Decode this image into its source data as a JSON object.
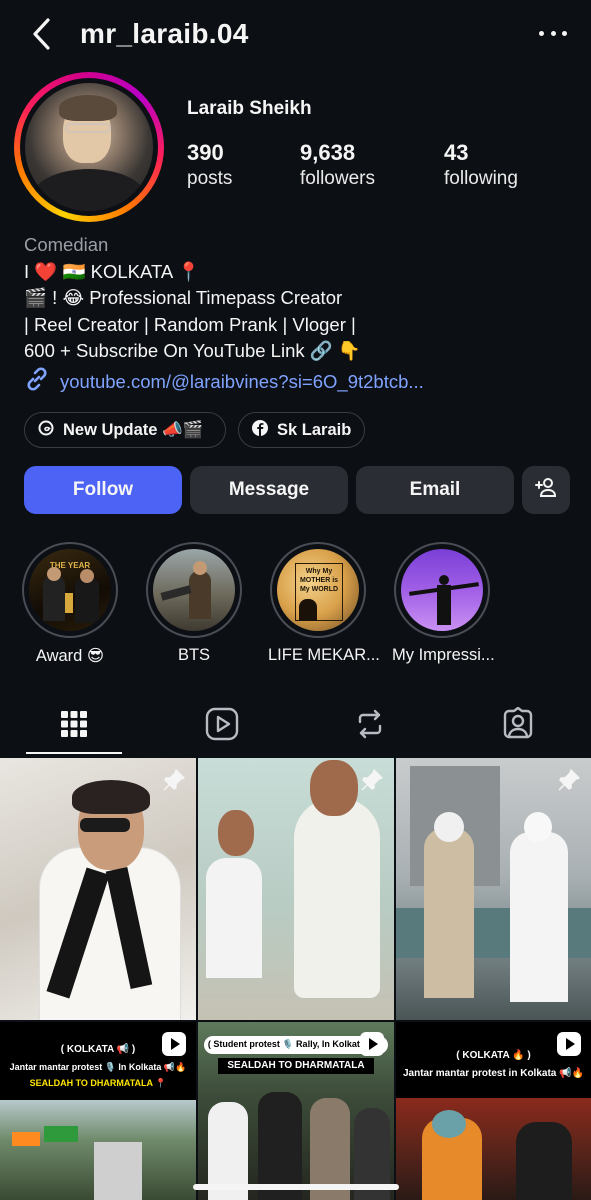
{
  "header": {
    "username": "mr_laraib.04"
  },
  "profile": {
    "display_name": "Laraib Sheikh",
    "stats": [
      {
        "value": "390",
        "label": "posts"
      },
      {
        "value": "9,638",
        "label": "followers"
      },
      {
        "value": "43",
        "label": "following"
      }
    ],
    "category": "Comedian",
    "bio_lines": [
      "I ❤️ 🇮🇳 KOLKATA 📍",
      "🎬 ! 😂 Professional Timepass Creator",
      "| Reel Creator | Random Prank | Vloger |",
      "600 + Subscribe On YouTube Link 🔗 👇"
    ],
    "link": "youtube.com/@laraibvines?si=6O_9t2btcb..."
  },
  "chips": [
    {
      "label": "New Update 📣🎬",
      "icon": "threads-icon"
    },
    {
      "label": "Sk Laraib",
      "icon": "facebook-icon"
    }
  ],
  "actions": {
    "follow": "Follow",
    "message": "Message",
    "email": "Email"
  },
  "highlights": [
    {
      "label": "Award 😎",
      "tag": "THE YEAR"
    },
    {
      "label": "BTS"
    },
    {
      "label": "LIFE MEKAR...",
      "tag": "Why My MOTHER is My WORLD"
    },
    {
      "label": "My Impressi..."
    }
  ],
  "tabs": [
    "grid-icon",
    "reels-icon",
    "reposts-icon",
    "tagged-icon"
  ],
  "posts": [
    {
      "pinned": true
    },
    {
      "pinned": true
    },
    {
      "pinned": true
    },
    {
      "caption_1": "( KOLKATA 📢 )",
      "caption_2": "Jantar mantar protest 🎙️ In Kolkata 📢🔥",
      "caption_3": "SEALDAH TO DHARMATALA 📍"
    },
    {
      "caption_1": "( Student protest 🎙️ Rally, In Kolkata 📍 )",
      "caption_2": "SEALDAH TO DHARMATALA"
    },
    {
      "caption_1": "( KOLKATA 🔥 )",
      "caption_2": "Jantar mantar protest in Kolkata 📢🔥"
    }
  ],
  "colors": {
    "background": "#0c0f14",
    "follow_button": "#4c63f6",
    "secondary_button": "#2a2d33",
    "link": "#7fa3ff",
    "muted_text": "#9a9ea6"
  }
}
